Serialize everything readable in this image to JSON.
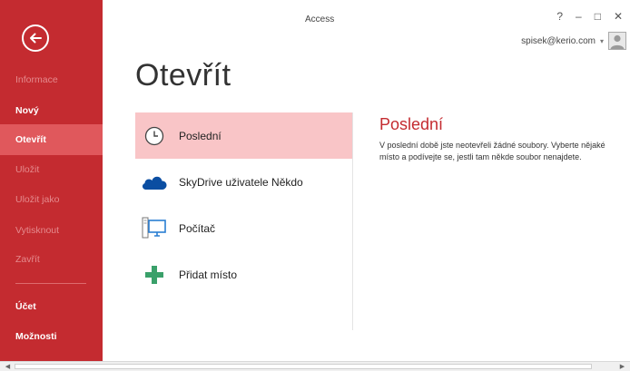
{
  "app": {
    "title": "Access"
  },
  "window": {
    "help": "?",
    "minimize": "–",
    "maximize": "□",
    "close": "✕"
  },
  "account": {
    "email": "spisek@kerio.com",
    "caret": "▾"
  },
  "sidebar": {
    "items": [
      {
        "label": "Informace",
        "state": "disabled"
      },
      {
        "label": "Nový",
        "state": "normal"
      },
      {
        "label": "Otevřít",
        "state": "active"
      },
      {
        "label": "Uložit",
        "state": "disabled"
      },
      {
        "label": "Uložit jako",
        "state": "disabled"
      },
      {
        "label": "Vytisknout",
        "state": "disabled"
      },
      {
        "label": "Zavřít",
        "state": "disabled"
      },
      {
        "label": "Účet",
        "state": "normal"
      },
      {
        "label": "Možnosti",
        "state": "normal"
      }
    ]
  },
  "main": {
    "title": "Otevřít",
    "places": [
      {
        "label": "Poslední",
        "icon": "clock-icon",
        "selected": true
      },
      {
        "label": "SkyDrive uživatele Někdo",
        "icon": "cloud-icon",
        "selected": false
      },
      {
        "label": "Počítač",
        "icon": "computer-icon",
        "selected": false
      },
      {
        "label": "Přidat místo",
        "icon": "plus-icon",
        "selected": false
      }
    ]
  },
  "right_pane": {
    "title": "Poslední",
    "text": "V poslední době jste neotevřeli žádné soubory. Vyberte nějaké místo a podívejte se, jestli tam někde soubor nenajdete."
  },
  "colors": {
    "accent": "#c42b30",
    "active_item": "#e0585c",
    "selected_place": "#f9c5c7",
    "disabled_text": "#e58a8d"
  }
}
